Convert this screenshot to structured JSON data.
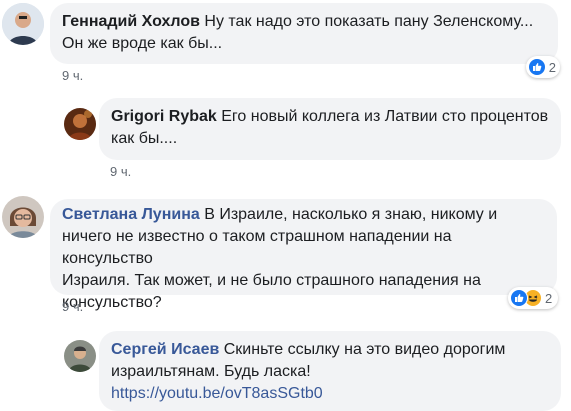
{
  "comments": [
    {
      "author": "Геннадий Хохлов",
      "text_l1": " Ну так надо это показать пану Зеленскому...",
      "text_l2": "Он же вроде как бы...",
      "time": "9 ч.",
      "reaction_count": "2",
      "reaction_icons": [
        "like-icon"
      ]
    },
    {
      "author": "Grigori Rybak",
      "text_l1": " Его новый коллега из Латвии сто процентов",
      "text_l2": "как бы....",
      "time": "9 ч."
    },
    {
      "author": "Светлана Лунина",
      "text_l1": " В Израиле, насколько я знаю, никому и",
      "text_l2": "ничего не известно о таком страшном нападении на консульство",
      "text_l3": "Израиля. Так может, и не было страшного нападения на",
      "text_l4": "консульство?",
      "time": "9 ч.",
      "reaction_count": "2",
      "reaction_icons": [
        "like-icon",
        "haha-icon"
      ]
    },
    {
      "author": "Сергей Исаев",
      "text_l1": " Скиньте ссылку на это видео дорогим",
      "text_l2": "израильтянам. Будь ласка!",
      "link": "https://youtu.be/ovT8asSGtb0"
    }
  ],
  "colors": {
    "bubble": "#f2f3f5",
    "link": "#385898",
    "like_blue": "#1877f2",
    "haha_yellow": "#f7b125"
  }
}
